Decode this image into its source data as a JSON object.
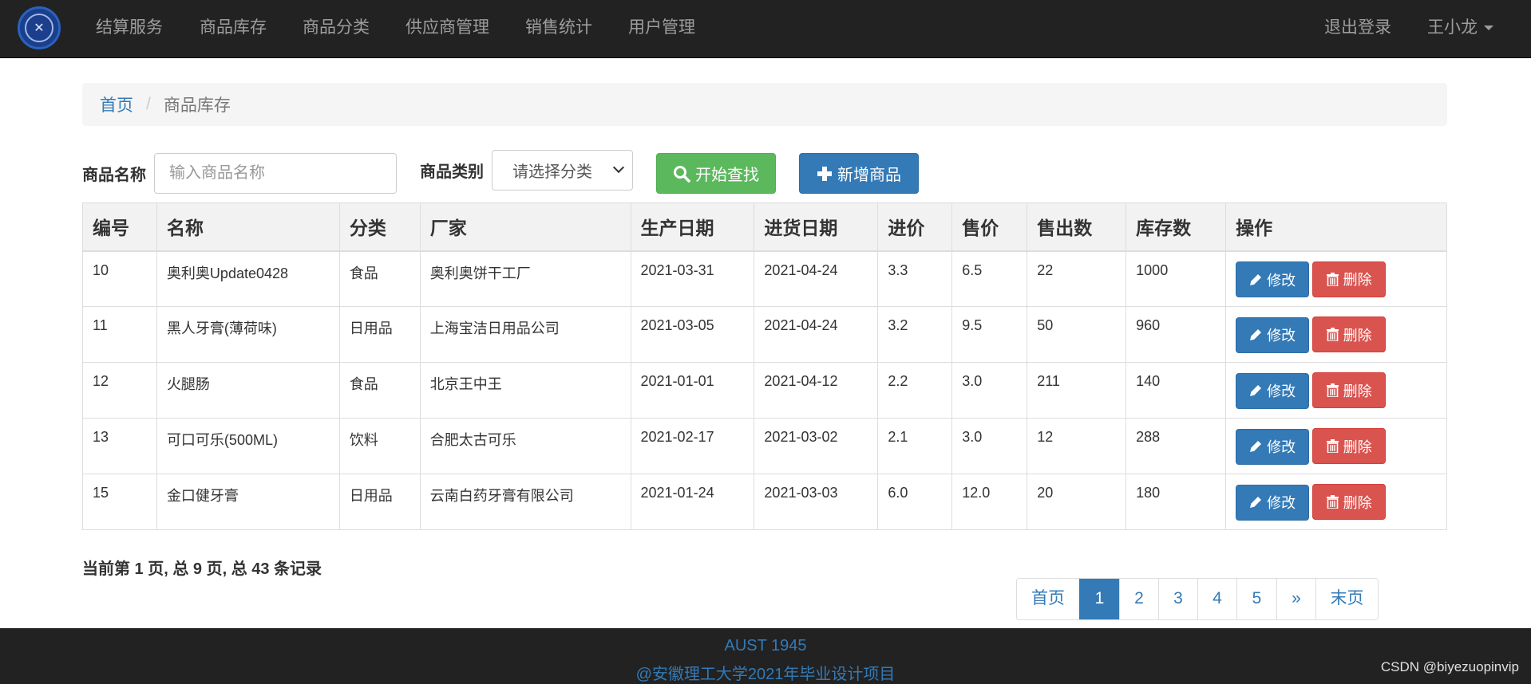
{
  "nav": {
    "items": [
      "结算服务",
      "商品库存",
      "商品分类",
      "供应商管理",
      "销售统计",
      "用户管理"
    ],
    "logout": "退出登录",
    "user": "王小龙"
  },
  "breadcrumb": {
    "home": "首页",
    "current": "商品库存"
  },
  "search": {
    "name_label": "商品名称",
    "name_placeholder": "输入商品名称",
    "category_label": "商品类别",
    "category_value": "请选择分类",
    "search_button": "开始查找",
    "add_button": "新增商品"
  },
  "table": {
    "headers": [
      "编号",
      "名称",
      "分类",
      "厂家",
      "生产日期",
      "进货日期",
      "进价",
      "售价",
      "售出数",
      "库存数",
      "操作"
    ],
    "edit_label": "修改",
    "delete_label": "删除",
    "rows": [
      [
        "10",
        "奥利奥Update0428",
        "食品",
        "奥利奥饼干工厂",
        "2021-03-31",
        "2021-04-24",
        "3.3",
        "6.5",
        "22",
        "1000"
      ],
      [
        "11",
        "黑人牙膏(薄荷味)",
        "日用品",
        "上海宝洁日用品公司",
        "2021-03-05",
        "2021-04-24",
        "3.2",
        "9.5",
        "50",
        "960"
      ],
      [
        "12",
        "火腿肠",
        "食品",
        "北京王中王",
        "2021-01-01",
        "2021-04-12",
        "2.2",
        "3.0",
        "211",
        "140"
      ],
      [
        "13",
        "可口可乐(500ML)",
        "饮料",
        "合肥太古可乐",
        "2021-02-17",
        "2021-03-02",
        "2.1",
        "3.0",
        "12",
        "288"
      ],
      [
        "15",
        "金口健牙膏",
        "日用品",
        "云南白药牙膏有限公司",
        "2021-01-24",
        "2021-03-03",
        "6.0",
        "12.0",
        "20",
        "180"
      ]
    ]
  },
  "record_info": "当前第 1 页, 总 9 页, 总 43 条记录",
  "pagination": {
    "first": "首页",
    "pages": [
      "1",
      "2",
      "3",
      "4",
      "5"
    ],
    "next": "»",
    "last": "末页",
    "active": "1"
  },
  "footer": {
    "line1": "AUST 1945",
    "line2": "@安徽理工大学2021年毕业设计项目"
  },
  "watermark": "CSDN @biyezuopinvip",
  "colors": {
    "navbar": "#222222",
    "primary": "#337ab7",
    "success": "#5cb85c",
    "danger": "#d9534f"
  }
}
